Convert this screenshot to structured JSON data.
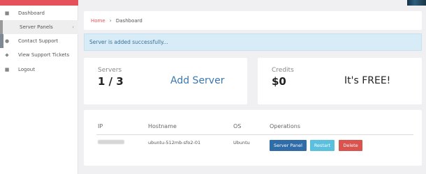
{
  "sidebar": {
    "items": [
      {
        "label": "Dashboard",
        "icon": "dashboard-icon"
      },
      {
        "label": "Server Panels",
        "icon": "server-icon"
      },
      {
        "label": "Contact Support",
        "icon": "user-icon"
      },
      {
        "label": "View Support Tickets",
        "icon": "ticket-icon"
      },
      {
        "label": "Logout",
        "icon": "lock-icon"
      }
    ]
  },
  "breadcrumb": {
    "home": "Home",
    "current": "Dashboard"
  },
  "alert": {
    "message": "Server is added successfully..."
  },
  "stats": {
    "servers_label": "Servers",
    "servers_value": "1 / 3",
    "add_server": "Add Server",
    "credits_label": "Credits",
    "credits_value": "$0",
    "free_text": "It's FREE!"
  },
  "table": {
    "headers": [
      "IP",
      "Hostname",
      "OS",
      "Operations"
    ],
    "rows": [
      {
        "hostname": "ubuntu-512mb-sfo2-01",
        "os": "Ubuntu"
      }
    ]
  },
  "buttons": {
    "panel": "Server Panel",
    "restart": "Restart",
    "delete": "Delete"
  },
  "colors": {
    "accent": "#e6525a",
    "primary": "#2f6ca8",
    "info": "#5bc0de",
    "danger": "#d9534f"
  }
}
